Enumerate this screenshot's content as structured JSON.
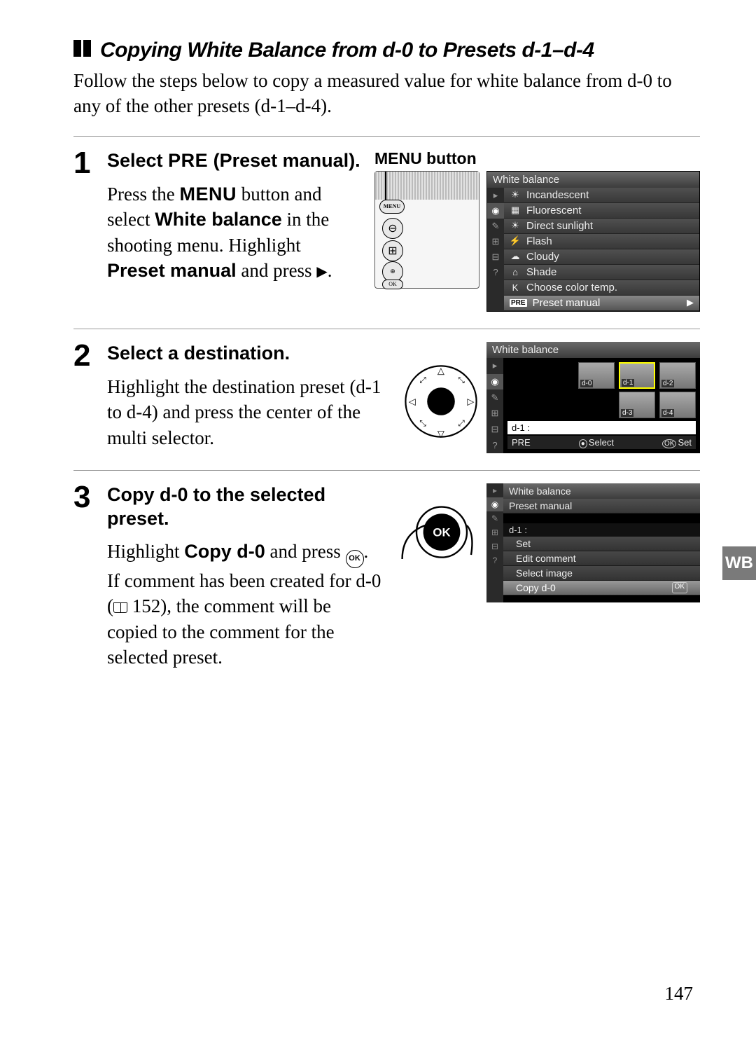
{
  "heading": "Copying White Balance from d-0 to Presets d-1–d-4",
  "intro": "Follow the steps below to copy a measured value for white balance from d-0 to any of the other presets (d-1–d-4).",
  "steps": {
    "s1": {
      "num": "1",
      "title_a": "Select ",
      "title_pre": "PRE",
      "title_b": " (",
      "title_bold": "Preset manual",
      "title_c": ").",
      "desc_a": "Press the ",
      "desc_menu": "MENU",
      "desc_b": " button and select ",
      "desc_wb": "White balance",
      "desc_c": " in the shooting menu. Highlight ",
      "desc_pm": "Preset manual",
      "desc_d": " and press ",
      "desc_e": ".",
      "fig_label": "MENU button"
    },
    "s2": {
      "num": "2",
      "title": "Select a destination.",
      "desc": "Highlight the destination preset (d-1 to d-4) and press the center of the multi selector."
    },
    "s3": {
      "num": "3",
      "title": "Copy d-0 to the selected preset.",
      "desc_a": "Highlight ",
      "desc_bold": "Copy d-0",
      "desc_b": " and press ",
      "desc_c": ". If comment has been created for d-0 (",
      "desc_ref": " 152",
      "desc_d": "), the comment will be copied to the comment for the selected preset."
    }
  },
  "menu1": {
    "title": "White balance",
    "items": [
      "Incandescent",
      "Fluorescent",
      "Direct sunlight",
      "Flash",
      "Cloudy",
      "Shade",
      "Choose color temp.",
      "Preset manual"
    ],
    "pre_label": "PRE"
  },
  "preset_screen": {
    "title": "White balance",
    "thumbs": [
      "d-0",
      "d-1",
      "d-2",
      "d-3",
      "d-4"
    ],
    "field": "d-1  :",
    "footer_pre": "PRE",
    "footer_select": "Select",
    "footer_set": "Set",
    "footer_ok": "OK"
  },
  "pm_screen": {
    "title": "White balance",
    "subtitle": "Preset manual",
    "field": "d-1    :",
    "items": [
      "Set",
      "Edit comment",
      "Select image",
      "Copy d-0"
    ],
    "ok": "OK"
  },
  "side_tab": "WB",
  "page_number": "147"
}
